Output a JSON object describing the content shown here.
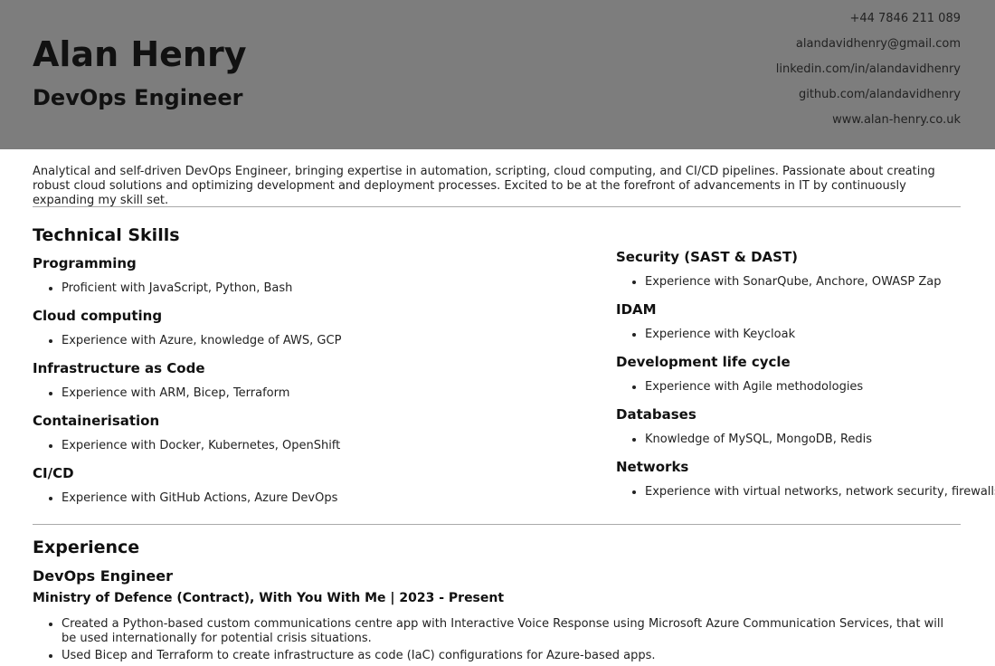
{
  "header": {
    "name": "Alan Henry",
    "title": "DevOps Engineer",
    "contacts": [
      "+44 7846 211 089",
      "alandavidhenry@gmail.com",
      "linkedin.com/in/alandavidhenry",
      "github.com/alandavidhenry",
      "www.alan-henry.co.uk"
    ]
  },
  "summary": "Analytical and self-driven DevOps Engineer, bringing expertise in automation, scripting, cloud computing, and CI/CD pipelines. Passionate about creating robust cloud solutions and optimizing development and deployment processes. Excited to be at the forefront of advancements in IT by continuously expanding my skill set.",
  "skills": {
    "heading": "Technical Skills",
    "left": [
      {
        "name": "Programming",
        "detail": "Proficient with JavaScript, Python, Bash"
      },
      {
        "name": "Cloud computing",
        "detail": "Experience with Azure, knowledge of AWS, GCP"
      },
      {
        "name": "Infrastructure as Code",
        "detail": "Experience with ARM, Bicep, Terraform"
      },
      {
        "name": "Containerisation",
        "detail": "Experience with Docker, Kubernetes, OpenShift"
      },
      {
        "name": "CI/CD",
        "detail": "Experience with GitHub Actions, Azure DevOps"
      }
    ],
    "right": [
      {
        "name": "Security (SAST & DAST)",
        "detail": "Experience with SonarQube, Anchore, OWASP Zap"
      },
      {
        "name": "IDAM",
        "detail": "Experience with Keycloak"
      },
      {
        "name": "Development life cycle",
        "detail": "Experience with Agile methodologies"
      },
      {
        "name": "Databases",
        "detail": "Knowledge of MySQL, MongoDB, Redis"
      },
      {
        "name": "Networks",
        "detail": "Experience with virtual networks, network security, firewalls"
      }
    ]
  },
  "experience": {
    "heading": "Experience",
    "role": "DevOps Engineer",
    "employer": "Ministry of Defence (Contract), With You With Me | 2023 - Present",
    "duties": [
      "Created a Python-based custom communications centre app with Interactive Voice Response using Microsoft Azure Communication Services, that will be used internationally for potential crisis situations.",
      "Used Bicep and Terraform to create infrastructure as code (IaC) configurations for Azure-based apps."
    ]
  }
}
